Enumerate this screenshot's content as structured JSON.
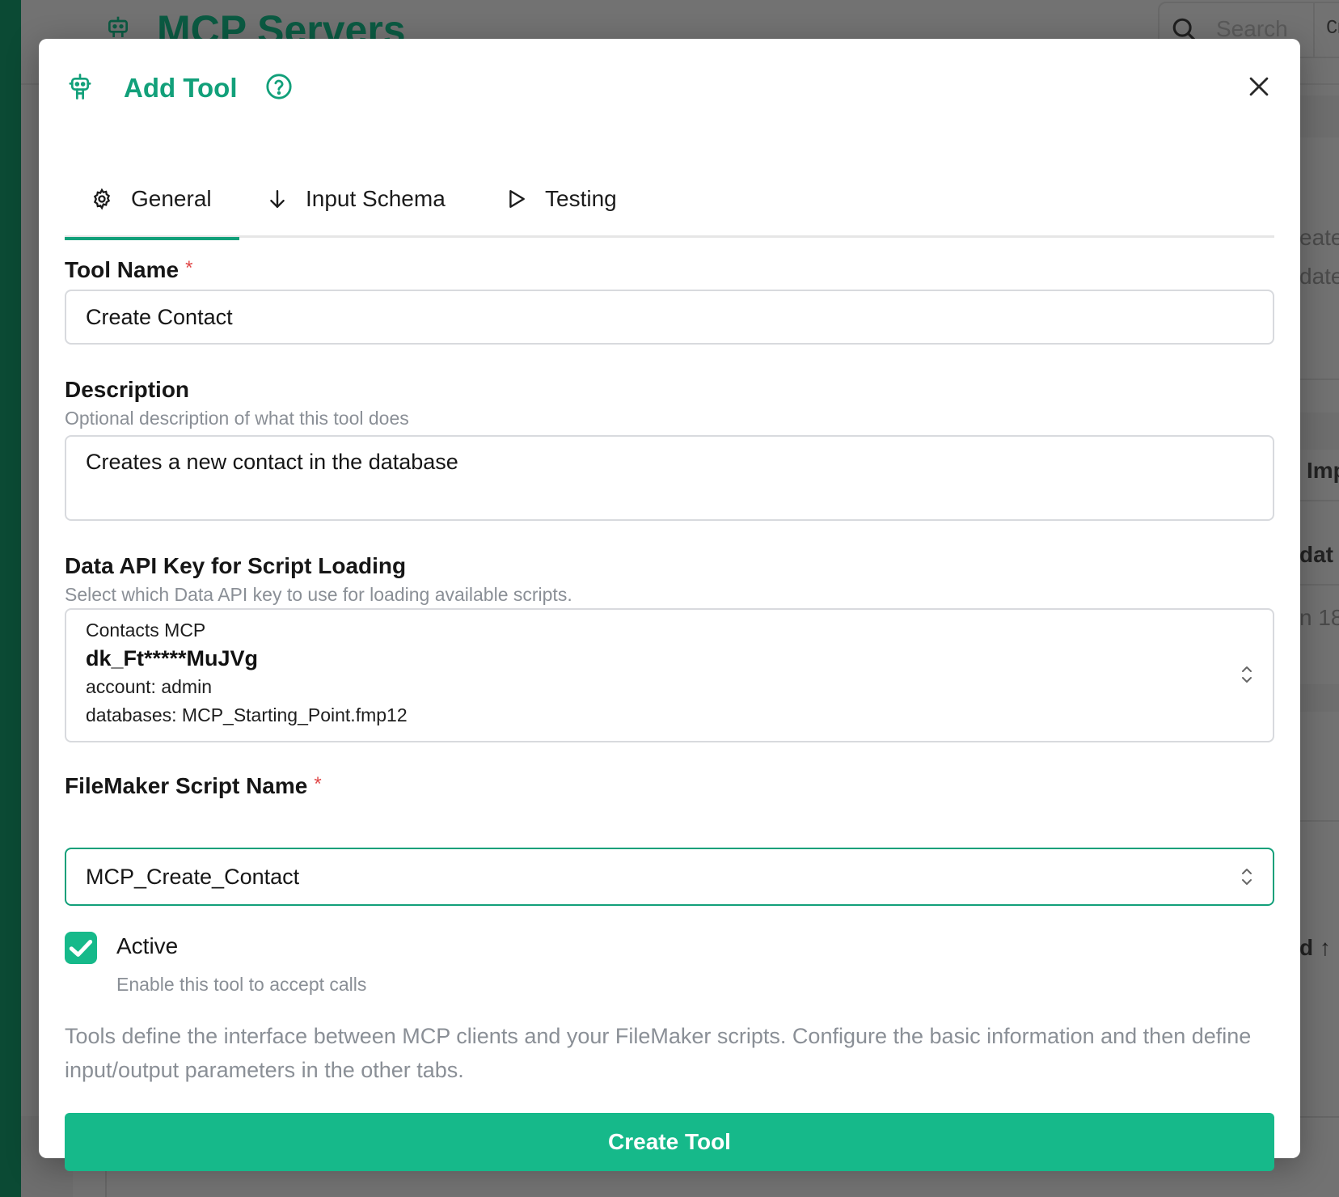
{
  "background": {
    "page_title": "MCP Servers",
    "search_placeholder": "Search",
    "search_shortcut": "Cmd",
    "fragments": [
      "eate",
      "date",
      "Imp",
      "dat",
      "n 18",
      "d ↑"
    ]
  },
  "modal": {
    "title": "Add Tool",
    "tabs": [
      {
        "label": "General",
        "icon": "gear-icon",
        "active": true
      },
      {
        "label": "Input Schema",
        "icon": "arrow-down-icon",
        "active": false
      },
      {
        "label": "Testing",
        "icon": "play-icon",
        "active": false
      }
    ],
    "tool_name": {
      "label": "Tool Name",
      "required_mark": "*",
      "value": "Create Contact"
    },
    "description": {
      "label": "Description",
      "hint": "Optional description of what this tool does",
      "value": "Creates a new contact in the database"
    },
    "api_key": {
      "label": "Data API Key for Script Loading",
      "hint": "Select which Data API key to use for loading available scripts.",
      "selected": {
        "name": "Contacts MCP",
        "key": "dk_Ft*****MuJVg",
        "account": "account: admin",
        "databases": "databases: MCP_Starting_Point.fmp12"
      }
    },
    "script_name": {
      "label": "FileMaker Script Name",
      "required_mark": "*",
      "value": "MCP_Create_Contact"
    },
    "active": {
      "label": "Active",
      "hint": "Enable this tool to accept calls",
      "checked": true
    },
    "info_text": "Tools define the interface between MCP clients and your FileMaker scripts. Configure the basic information and then define input/output parameters in the other tabs.",
    "submit_label": "Create Tool"
  },
  "colors": {
    "accent": "#12a07a",
    "button": "#16b98a",
    "required": "#e04848",
    "sidebar": "#0b4a34"
  }
}
